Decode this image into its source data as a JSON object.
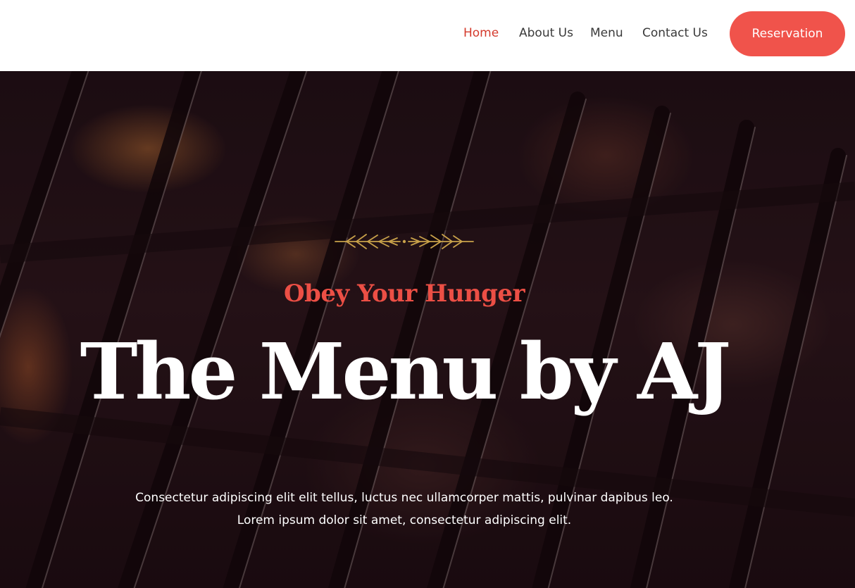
{
  "nav": {
    "links": [
      {
        "label": "Home",
        "active": true
      },
      {
        "label": "About Us",
        "active": false
      },
      {
        "label": "Menu",
        "active": false
      },
      {
        "label": "Contact Us",
        "active": false
      }
    ],
    "cta_label": "Reservation"
  },
  "hero": {
    "ornament_icon": "wheat-branches-ornament-icon",
    "subtitle": "Obey Your Hunger",
    "title": "The Menu by AJ",
    "description": "Consectetur adipiscing elit elit tellus, luctus nec ullamcorper mattis, pulvinar dapibus leo. Lorem ipsum dolor sit amet, consectetur adipiscing elit.",
    "background_description_icon": "grill-background-image"
  },
  "colors": {
    "accent": "#f0534b",
    "active_nav": "#d43a2c",
    "ornament": "#c9a24a"
  }
}
